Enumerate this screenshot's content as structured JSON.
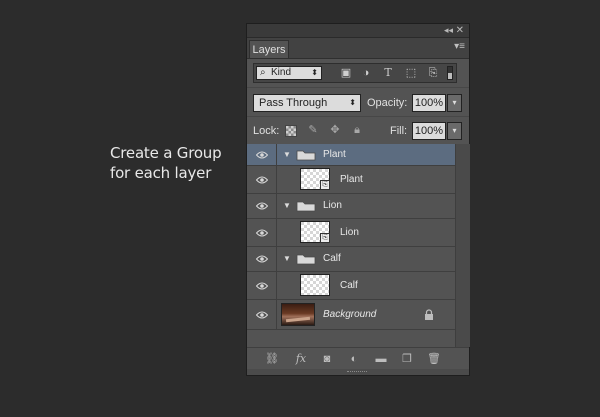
{
  "caption": {
    "line1": "Create a Group",
    "line2": "for each layer"
  },
  "panel": {
    "tab_label": "Layers",
    "filter": {
      "kind_label": "Kind",
      "icons": [
        "image-filter-icon",
        "adjustment-filter-icon",
        "type-filter-icon",
        "shape-filter-icon",
        "smart-object-filter-icon"
      ]
    },
    "blend_mode": "Pass Through",
    "opacity_label": "Opacity:",
    "opacity_value": "100%",
    "lock_label": "Lock:",
    "fill_label": "Fill:",
    "fill_value": "100%"
  },
  "layers": [
    {
      "type": "group",
      "name": "Plant",
      "selected": true
    },
    {
      "type": "smart-object",
      "name": "Plant"
    },
    {
      "type": "group",
      "name": "Lion"
    },
    {
      "type": "smart-object",
      "name": "Lion"
    },
    {
      "type": "group",
      "name": "Calf"
    },
    {
      "type": "smart-object",
      "name": "Calf"
    },
    {
      "type": "background",
      "name": "Background",
      "locked": true
    }
  ],
  "footer_icons": [
    "link-layers-icon",
    "fx-icon",
    "layer-mask-icon",
    "adjustment-layer-icon",
    "new-group-icon",
    "new-layer-icon",
    "trash-icon"
  ],
  "colors": {
    "background": "#2c2c2c",
    "panel": "#535353",
    "selection": "#5c6c80"
  }
}
